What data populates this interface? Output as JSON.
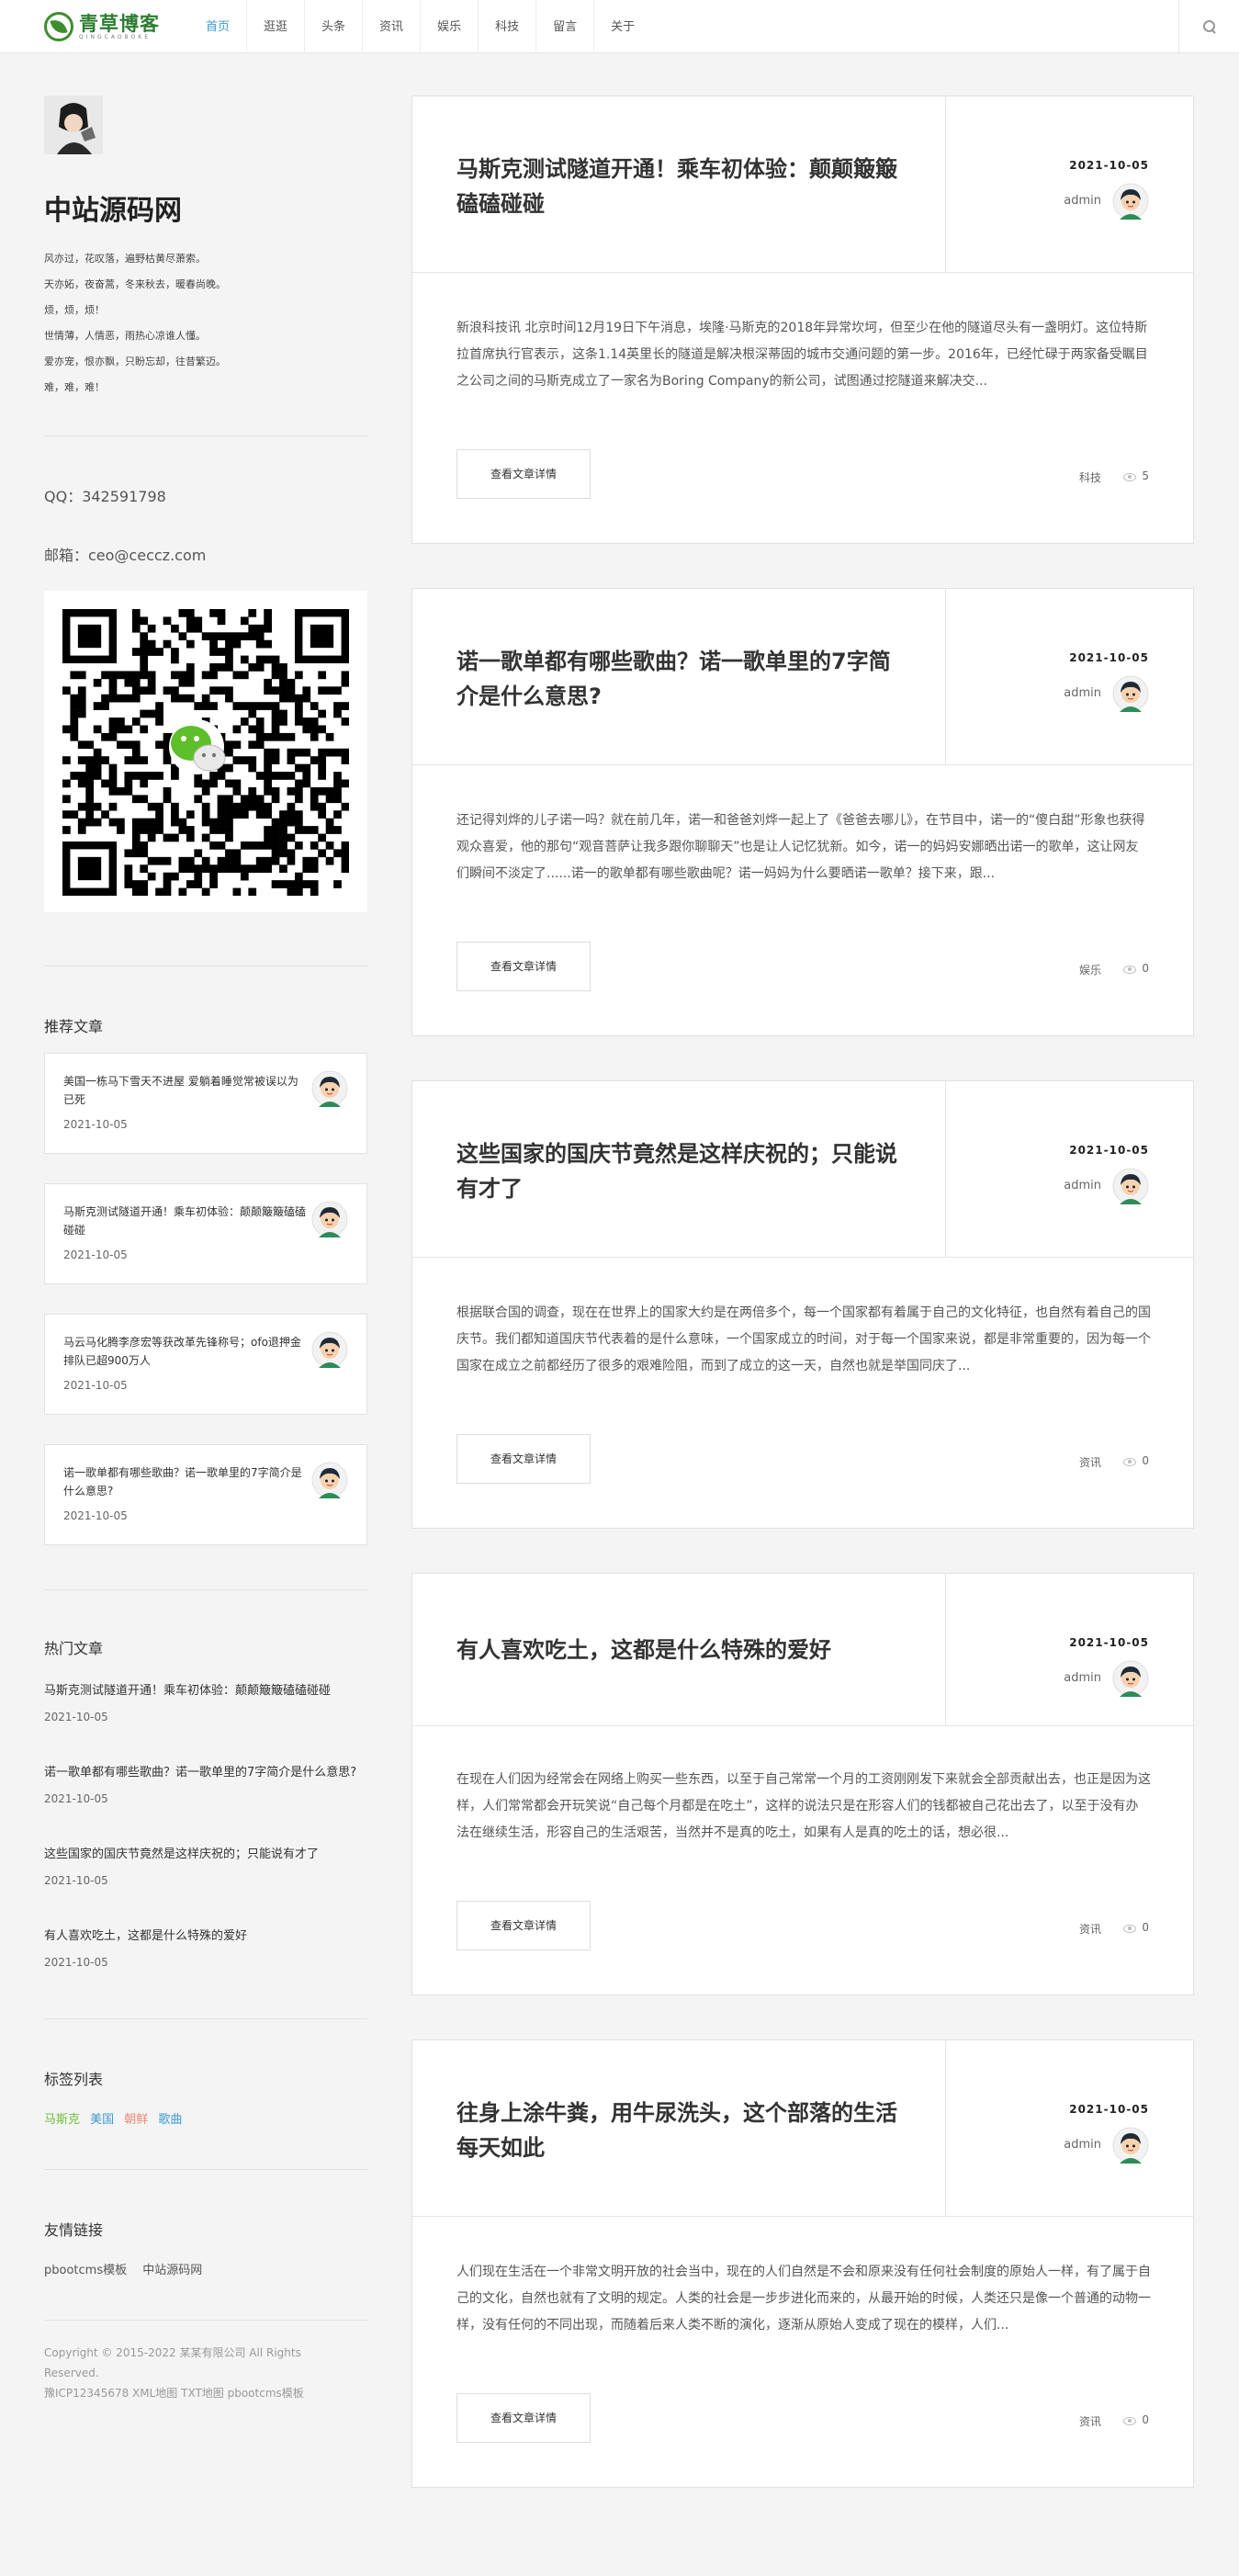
{
  "header": {
    "logo_title": "青草博客",
    "logo_sub": "QINGCAOBOKE",
    "nav": [
      "首页",
      "逛逛",
      "头条",
      "资讯",
      "娱乐",
      "科技",
      "留言",
      "关于"
    ],
    "active_index": 0,
    "accent": "#3d9bd1"
  },
  "sidebar": {
    "site_name": "中站源码网",
    "poem": [
      "风亦过，花叹落，遍野枯黄尽萧索。",
      "天亦妬，夜奋蒿，冬来秋去，暖春尚晚。",
      "烦，烦，烦！",
      "世情薄，人情恶，雨热心凉谁人懂。",
      "爱亦宠，恨亦飘，只盼忘却，往昔繁迈。",
      "难，难，难！"
    ],
    "qq": "QQ：342591798",
    "email": "邮箱：ceo@ceccz.com",
    "rec_title": "推荐文章",
    "rec": [
      {
        "title": "美国一栋马下雪天不进屋 爱躺着睡觉常被误以为已死",
        "date": "2021-10-05"
      },
      {
        "title": "马斯克测试隧道开通！乘车初体验：颠颠簸簸磕磕碰碰",
        "date": "2021-10-05"
      },
      {
        "title": "马云马化腾李彦宏等获改革先锋称号；ofo退押金排队已超900万人",
        "date": "2021-10-05"
      },
      {
        "title": "诺一歌单都有哪些歌曲？诺一歌单里的7字简介是什么意思?",
        "date": "2021-10-05"
      }
    ],
    "hot_title": "热门文章",
    "hot": [
      {
        "title": "马斯克测试隧道开通！乘车初体验：颠颠簸簸磕磕碰碰",
        "date": "2021-10-05"
      },
      {
        "title": "诺一歌单都有哪些歌曲？诺一歌单里的7字简介是什么意思?",
        "date": "2021-10-05"
      },
      {
        "title": "这些国家的国庆节竟然是这样庆祝的；只能说有才了",
        "date": "2021-10-05"
      },
      {
        "title": "有人喜欢吃土，这都是什么特殊的爱好",
        "date": "2021-10-05"
      }
    ],
    "tags_title": "标签列表",
    "tags": [
      {
        "label": "马斯克",
        "color": "#6cbf3b"
      },
      {
        "label": "美国",
        "color": "#3d9bd1"
      },
      {
        "label": "朝鲜",
        "color": "#e98a7b"
      },
      {
        "label": "歌曲",
        "color": "#3d9bd1"
      }
    ],
    "links_title": "友情链接",
    "links": [
      "pbootcms模板",
      "中站源码网"
    ],
    "footer": [
      "Copyright © 2015-2022 某某有限公司 All Rights",
      "Reserved.",
      "豫ICP12345678 XML地图 TXT地图 pbootcms模板"
    ]
  },
  "articles": [
    {
      "title": "马斯克测试隧道开通！乘车初体验：颠颠簸簸磕磕碰碰",
      "date": "2021-10-05",
      "author": "admin",
      "excerpt": "新浪科技讯 北京时间12月19日下午消息，埃隆·马斯克的2018年异常坎坷，但至少在他的隧道尽头有一盏明灯。这位特斯拉首席执行官表示，这条1.14英里长的隧道是解决根深蒂固的城市交通问题的第一步。2016年，已经忙碌于两家备受瞩目之公司之间的马斯克成立了一家名为Boring Company的新公司，试图通过挖隧道来解决交...",
      "button": "查看文章详情",
      "category": "科技",
      "views": "5"
    },
    {
      "title": "诺一歌单都有哪些歌曲？诺一歌单里的7字简介是什么意思?",
      "date": "2021-10-05",
      "author": "admin",
      "excerpt": "还记得刘烨的儿子诺一吗？就在前几年，诺一和爸爸刘烨一起上了《爸爸去哪儿》，在节目中，诺一的“傻白甜”形象也获得观众喜爱，他的那句“观音菩萨让我多跟你聊聊天”也是让人记忆犹新。如今，诺一的妈妈安娜晒出诺一的歌单，这让网友们瞬间不淡定了......诺一的歌单都有哪些歌曲呢？诺一妈妈为什么要晒诺一歌单？接下来，跟...",
      "button": "查看文章详情",
      "category": "娱乐",
      "views": "0"
    },
    {
      "title": "这些国家的国庆节竟然是这样庆祝的；只能说有才了",
      "date": "2021-10-05",
      "author": "admin",
      "excerpt": "根据联合国的调查，现在在世界上的国家大约是在两倍多个，每一个国家都有着属于自己的文化特征，也自然有着自己的国庆节。我们都知道国庆节代表着的是什么意味，一个国家成立的时间，对于每一个国家来说，都是非常重要的，因为每一个国家在成立之前都经历了很多的艰难险阻，而到了成立的这一天，自然也就是举国同庆了...",
      "button": "查看文章详情",
      "category": "资讯",
      "views": "0"
    },
    {
      "title": "有人喜欢吃土，这都是什么特殊的爱好",
      "date": "2021-10-05",
      "author": "admin",
      "excerpt": "在现在人们因为经常会在网络上购买一些东西，以至于自己常常一个月的工资刚刚发下来就会全部贡献出去，也正是因为这样，人们常常都会开玩笑说“自己每个月都是在吃土”，这样的说法只是在形容人们的钱都被自己花出去了，以至于没有办法在继续生活，形容自己的生活艰苦，当然并不是真的吃土，如果有人是真的吃土的话，想必很...",
      "button": "查看文章详情",
      "category": "资讯",
      "views": "0"
    },
    {
      "title": "往身上涂牛粪，用牛尿洗头，这个部落的生活每天如此",
      "date": "2021-10-05",
      "author": "admin",
      "excerpt": "人们现在生活在一个非常文明开放的社会当中，现在的人们自然是不会和原来没有任何社会制度的原始人一样，有了属于自己的文化，自然也就有了文明的规定。人类的社会是一步步进化而来的，从最开始的时候，人类还只是像一个普通的动物一样，没有任何的不同出现，而随着后来人类不断的演化，逐渐从原始人变成了现在的模样，人们...",
      "button": "查看文章详情",
      "category": "资讯",
      "views": "0"
    }
  ]
}
